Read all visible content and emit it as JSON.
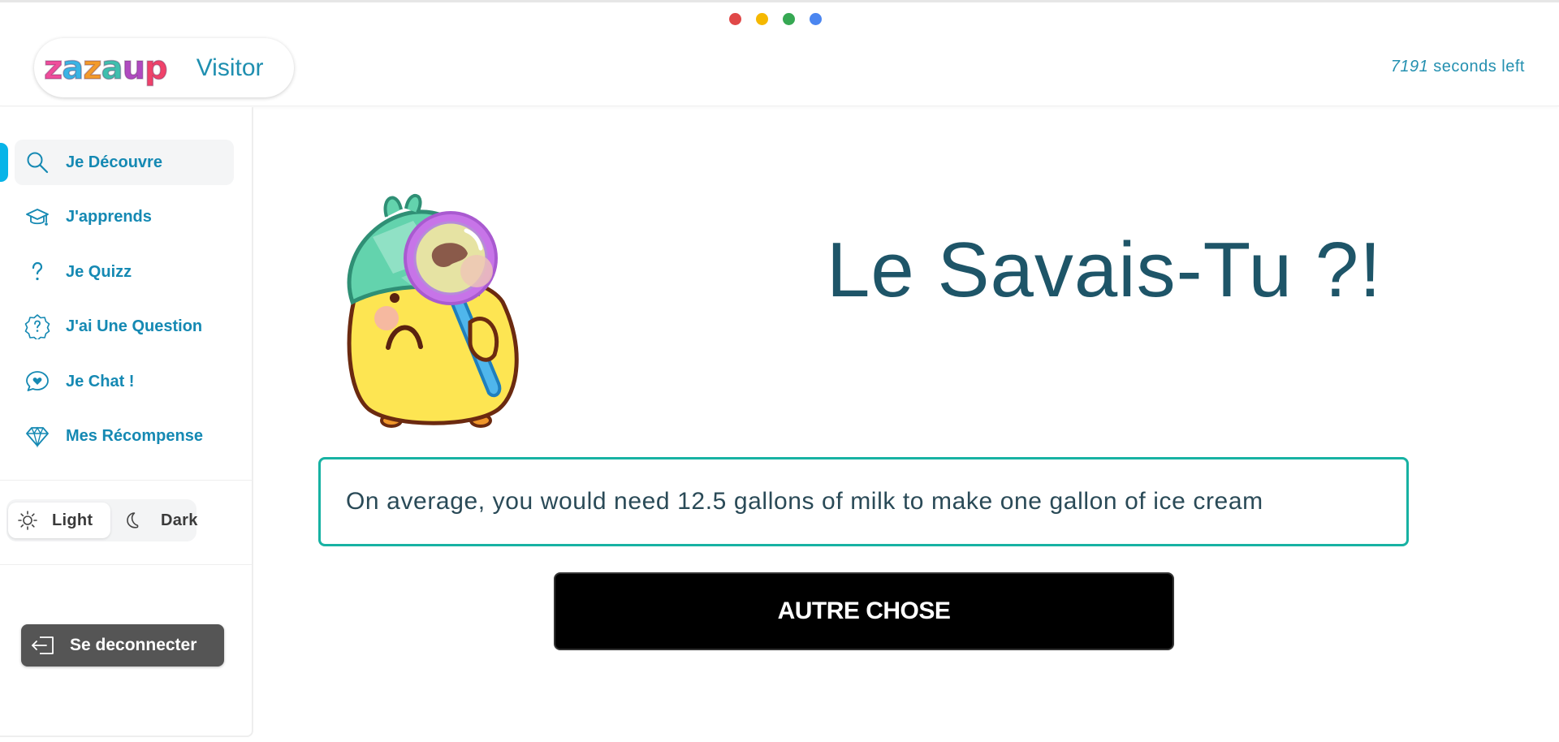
{
  "window_dots": [
    {
      "color": "#e04848"
    },
    {
      "color": "#f5b800"
    },
    {
      "color": "#36a853"
    },
    {
      "color": "#4b86f0"
    }
  ],
  "header": {
    "logo_letters": [
      {
        "char": "z",
        "color": "#ef4d9b"
      },
      {
        "char": "a",
        "color": "#39b4e4"
      },
      {
        "char": "z",
        "color": "#f39a2b"
      },
      {
        "char": "a",
        "color": "#3fbfae"
      },
      {
        "char": "u",
        "color": "#b04ac0"
      },
      {
        "char": "p",
        "color": "#f0426a"
      }
    ],
    "user_role": "Visitor",
    "timer_value": "7191",
    "timer_suffix": " seconds left"
  },
  "sidebar": {
    "items": [
      {
        "label": "Je Découvre",
        "icon": "search-icon",
        "active": true
      },
      {
        "label": "J'apprends",
        "icon": "graduation-cap-icon",
        "active": false
      },
      {
        "label": "Je Quizz",
        "icon": "question-mark-icon",
        "active": false
      },
      {
        "label": "J'ai Une Question",
        "icon": "question-badge-icon",
        "active": false
      },
      {
        "label": "Je Chat !",
        "icon": "chat-heart-icon",
        "active": false
      },
      {
        "label": "Mes Récompense",
        "icon": "diamond-icon",
        "active": false
      }
    ],
    "theme": {
      "light_label": "Light",
      "dark_label": "Dark",
      "selected": "Light"
    },
    "logout_label": "Se deconnecter"
  },
  "main": {
    "title": "Le Savais-Tu ?!",
    "fact": "On average, you would need 12.5 gallons of milk to make one gallon of ice cream",
    "button_label": "AUTRE CHOSE"
  },
  "colors": {
    "accent": "#1589b3",
    "active_marker": "#08b4e8",
    "fact_border": "#17b2a3",
    "title": "#1e5568"
  }
}
